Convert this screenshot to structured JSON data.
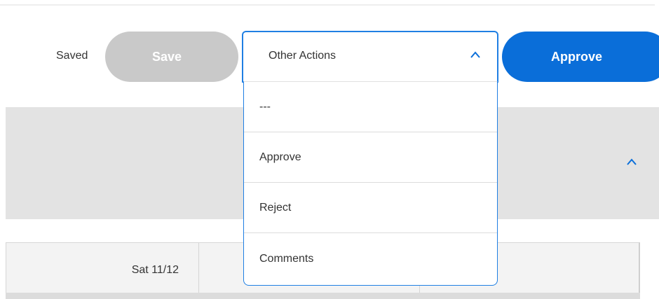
{
  "header": {
    "saved_status": "Saved",
    "save_label": "Save",
    "approve_label": "Approve"
  },
  "actions_select": {
    "label": "Other Actions",
    "expanded": true,
    "options": [
      "---",
      "Approve",
      "Reject",
      "Comments"
    ]
  },
  "grid": {
    "column_header": "Sat 11/12"
  },
  "colors": {
    "primary": "#0a6ed9",
    "disabled": "#c9c9c9",
    "focus_border": "#1f7fe3",
    "band": "#e3e3e3"
  },
  "icons": {
    "select_chevron": "chevron-up-icon",
    "section_chevron": "chevron-up-icon"
  }
}
